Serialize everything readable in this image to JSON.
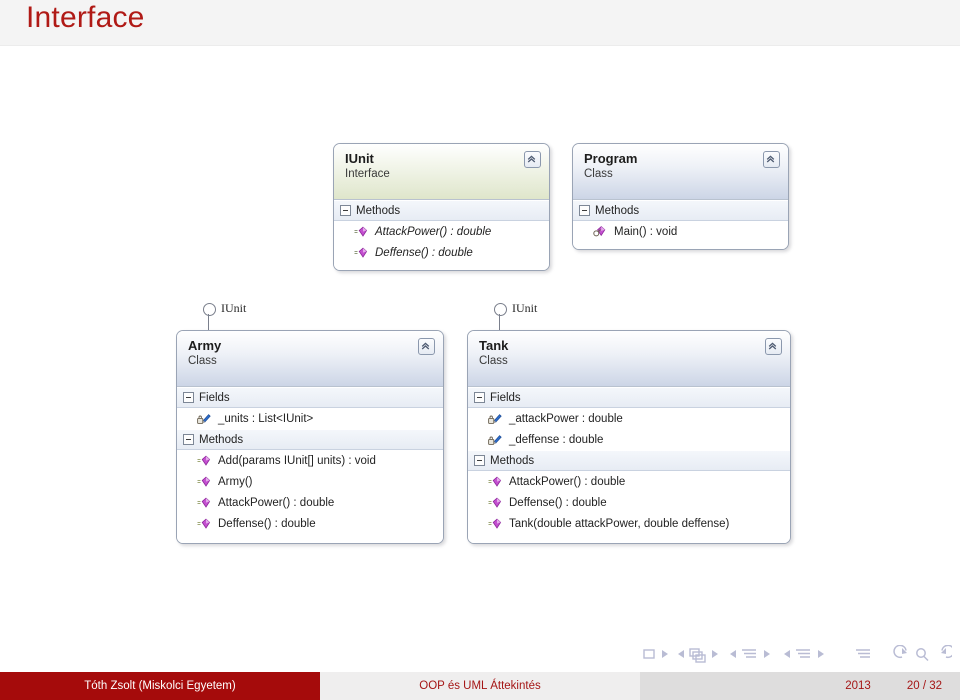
{
  "slide": {
    "title": "Interface",
    "title_color": "#b01a16"
  },
  "diagram": {
    "boxes": [
      {
        "id": "iunit",
        "name": "IUnit",
        "kind": "Interface",
        "collapse_icon": "chevron-double-up-icon",
        "sections": [
          {
            "label": "Methods",
            "members": [
              {
                "icon": "interface-method-icon",
                "text": "AttackPower() : double",
                "italic": true
              },
              {
                "icon": "interface-method-icon",
                "text": "Deffense() : double",
                "italic": true
              }
            ]
          }
        ]
      },
      {
        "id": "program",
        "name": "Program",
        "kind": "Class",
        "collapse_icon": "chevron-double-up-icon",
        "sections": [
          {
            "label": "Methods",
            "members": [
              {
                "icon": "private-method-icon",
                "text": "Main() : void",
                "italic": false
              }
            ]
          }
        ]
      },
      {
        "id": "army",
        "name": "Army",
        "kind": "Class",
        "collapse_icon": "chevron-double-up-icon",
        "lollipop": "IUnit",
        "sections": [
          {
            "label": "Fields",
            "members": [
              {
                "icon": "private-field-icon",
                "text": "_units : List<IUnit>",
                "italic": false
              }
            ]
          },
          {
            "label": "Methods",
            "members": [
              {
                "icon": "public-method-icon",
                "text": "Add(params IUnit[] units) : void",
                "italic": false
              },
              {
                "icon": "public-method-icon",
                "text": "Army()",
                "italic": false
              },
              {
                "icon": "public-method-icon",
                "text": "AttackPower() : double",
                "italic": false
              },
              {
                "icon": "public-method-icon",
                "text": "Deffense() : double",
                "italic": false
              }
            ]
          }
        ]
      },
      {
        "id": "tank",
        "name": "Tank",
        "kind": "Class",
        "collapse_icon": "chevron-double-up-icon",
        "lollipop": "IUnit",
        "sections": [
          {
            "label": "Fields",
            "members": [
              {
                "icon": "private-field-icon",
                "text": "_attackPower : double",
                "italic": false
              },
              {
                "icon": "private-field-icon",
                "text": "_deffense : double",
                "italic": false
              }
            ]
          },
          {
            "label": "Methods",
            "members": [
              {
                "icon": "public-method-icon",
                "text": "AttackPower() : double",
                "italic": false
              },
              {
                "icon": "public-method-icon",
                "text": "Deffense() : double",
                "italic": false
              },
              {
                "icon": "public-method-icon",
                "text": "Tank(double attackPower, double deffense)",
                "italic": false
              }
            ]
          }
        ]
      }
    ]
  },
  "nav": {
    "items": [
      "slide-square-icon",
      "next-slide-icon",
      "prev-frame-icon",
      "frames-icon",
      "next-frame-icon",
      "prev-subsection-icon",
      "subsection-icon",
      "next-subsection-icon",
      "prev-section-icon",
      "section-icon",
      "next-section-icon",
      "document-icon",
      "back-icon",
      "search-icon",
      "forward-icon"
    ]
  },
  "footer": {
    "author": "Tóth Zsolt  (Miskolci Egyetem)",
    "title": "OOP és UML Áttekintés",
    "year": "2013",
    "page": "20 / 32",
    "author_bg": "#a50b0b",
    "accent": "#a51616"
  }
}
